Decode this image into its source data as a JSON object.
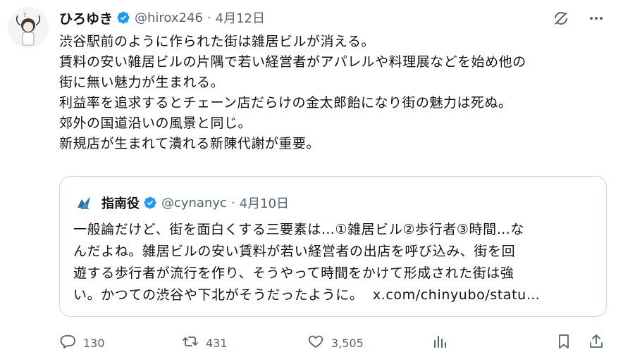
{
  "author": {
    "display_name": "ひろゆき",
    "handle": "@hirox246",
    "separator": "·",
    "date": "4月12日"
  },
  "body_lines": [
    "渋谷駅前のように作られた街は雑居ビルが消える。",
    "賃料の安い雑居ビルの片隅で若い経営者がアパレルや料理展などを始め他の",
    "街に無い魅力が生まれる。",
    "利益率を追求するとチェーン店だらけの金太郎飴になり街の魅力は死ぬ。",
    "郊外の国道沿いの風景と同じ。",
    "新規店が生まれて潰れる新陳代謝が重要。"
  ],
  "quote": {
    "display_name": "指南役",
    "handle": "@cynanyc",
    "separator": "·",
    "date": "4月10日",
    "lines": [
      "一般論だけど、街を面白くする三要素は…①雑居ビル②歩行者③時間…な",
      "んだよね。雑居ビルの安い賃料が若い経営者の出店を呼び込み、街を回",
      "遊する歩行者が流行を作り、そうやって時間をかけて形成された街は強",
      "い。かつての渋谷や下北がそうだったように。"
    ],
    "link": "x.com/chinyubo/statu…"
  },
  "stats": {
    "replies": "130",
    "reposts": "431",
    "likes": "3,505"
  },
  "icons": {
    "verified": "verified-badge-icon",
    "grok": "grok-icon",
    "more": "more-icon",
    "reply": "reply-icon",
    "repost": "repost-icon",
    "like": "heart-icon",
    "views": "views-icon",
    "bookmark": "bookmark-icon",
    "share": "share-icon"
  },
  "colors": {
    "verified_blue": "#1d9bf0",
    "muted_gray": "#536471",
    "border": "#cfd9de"
  }
}
